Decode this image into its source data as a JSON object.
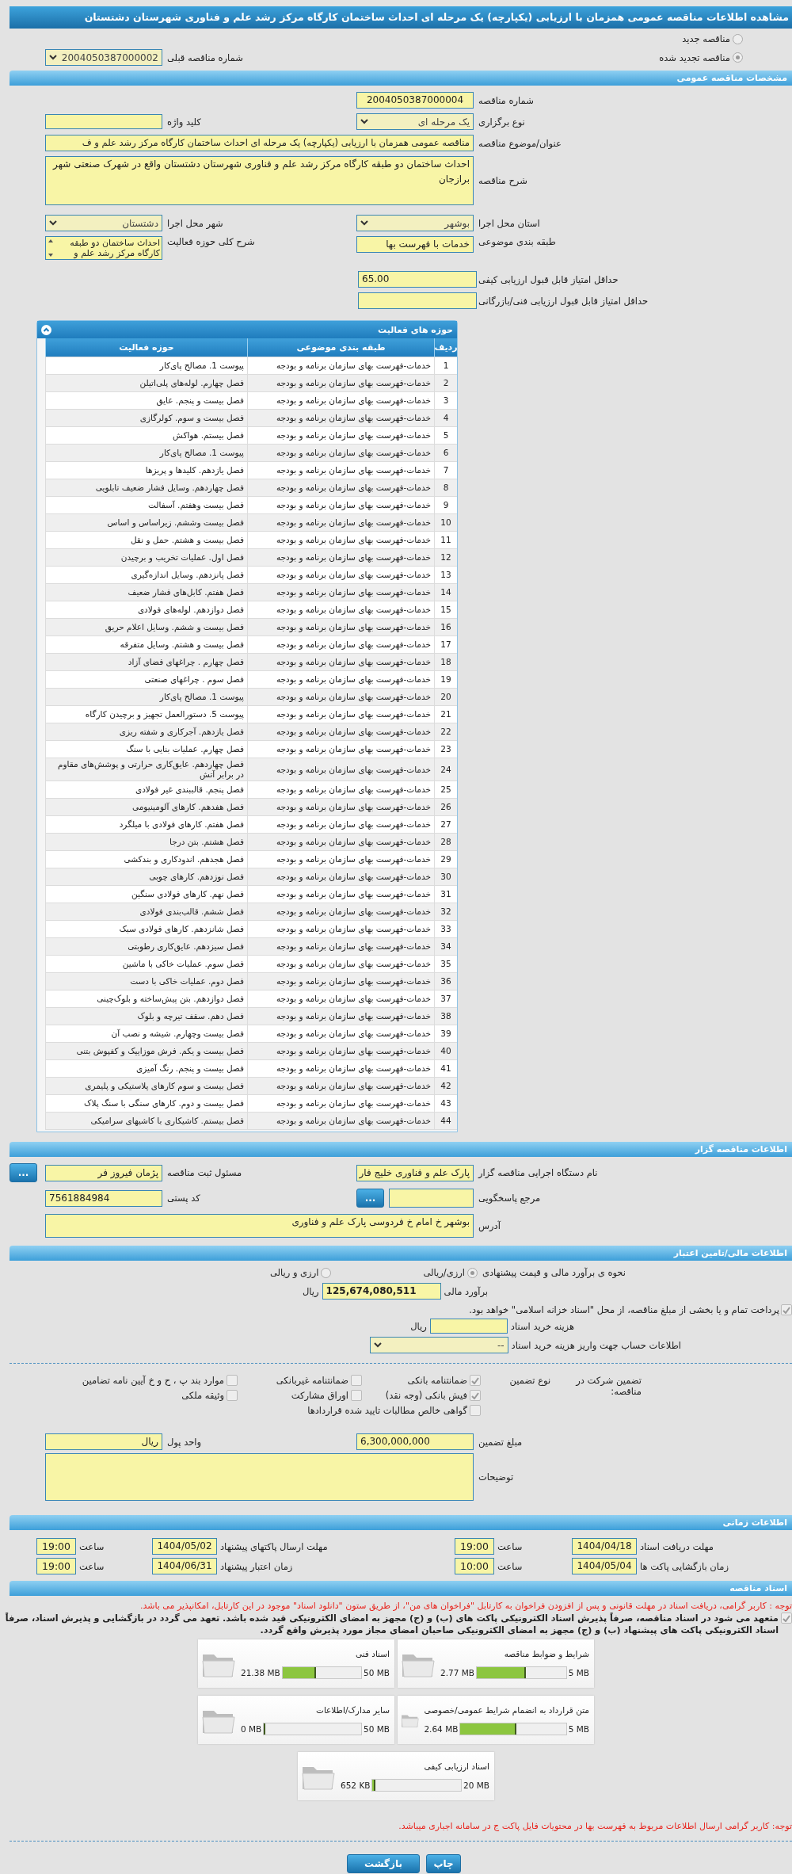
{
  "page_title": "مشاهده اطلاعات مناقصه عمومی همزمان با ارزیابی (یکپارچه) یک مرحله ای احداث ساختمان کارگاه مرکز رشد علم و فناوری شهرستان دشتستان",
  "tender_kind": [
    {
      "label": "مناقصه جدید",
      "selected": false
    },
    {
      "label": "مناقصه تجدید شده",
      "selected": true
    }
  ],
  "previous_tender": {
    "label": "شماره مناقصه قبلی",
    "value": "2004050387000002"
  },
  "general": {
    "title": "مشخصات مناقصه عمومی",
    "tender_number": {
      "label": "شماره مناقصه",
      "value": "2004050387000004"
    },
    "holding_type": {
      "label": "نوع برگزاری",
      "value": "یک مرحله ای"
    },
    "keyword": {
      "label": "کلید واژه"
    },
    "subject": {
      "label": "عنوان/موضوع مناقصه",
      "value": "مناقصه عمومی همزمان با ارزیابی (یکپارچه) یک مرحله ای احداث ساختمان کارگاه مرکز رشد علم و ف"
    },
    "description": {
      "label": "شرح مناقصه",
      "value": "احداث ساختمان دو طبقه کارگاه مرکز رشد علم و فناوری شهرستان دشتستان واقع در شهرک صنعتی شهر برازجان"
    },
    "province": {
      "label": "استان محل اجرا",
      "value": "بوشهر"
    },
    "city": {
      "label": "شهر محل اجرا",
      "value": "دشتستان"
    },
    "category": {
      "label": "طبقه بندی موضوعی",
      "value": "خدمات با فهرست بها"
    },
    "activity_summary": {
      "label": "شرح کلی حوزه فعالیت",
      "value": "احداث ساختمان دو طبقه کارگاه مرکز رشد علم و"
    },
    "quality_min": {
      "label": "حداقل امتیاز قابل قبول ارزیابی کیفی",
      "value": "65.00"
    },
    "technical_min": {
      "label": "حداقل امتیاز قابل قبول ارزیابی فنی/بازرگانی"
    }
  },
  "activities": {
    "title": "حوزه های فعالیت",
    "columns": [
      "ردیف",
      "طبقه بندی موضوعی",
      "حوزه فعالیت"
    ],
    "rows": [
      {
        "row": "1",
        "category": "خدمات-فهرست بهای سازمان برنامه و بودجه",
        "activity": "پیوست 1. مصالح پای‌کار"
      },
      {
        "row": "2",
        "category": "خدمات-فهرست بهای سازمان برنامه و بودجه",
        "activity": "فصل چهارم. لوله‌های پلی‌اتیلن"
      },
      {
        "row": "3",
        "category": "خدمات-فهرست بهای سازمان برنامه و بودجه",
        "activity": "فصل بیست و پنجم. عایق"
      },
      {
        "row": "4",
        "category": "خدمات-فهرست بهای سازمان برنامه و بودجه",
        "activity": "فصل بیست و سوم. کولرگازی"
      },
      {
        "row": "5",
        "category": "خدمات-فهرست بهای سازمان برنامه و بودجه",
        "activity": "فصل بیستم. هواکش"
      },
      {
        "row": "6",
        "category": "خدمات-فهرست بهای سازمان برنامه و بودجه",
        "activity": "پیوست 1. مصالح پای‌کار"
      },
      {
        "row": "7",
        "category": "خدمات-فهرست بهای سازمان برنامه و بودجه",
        "activity": "فصل یازدهم. کلیدها و پریزها"
      },
      {
        "row": "8",
        "category": "خدمات-فهرست بهای سازمان برنامه و بودجه",
        "activity": "فصل چهاردهم. وسایل فشار ضعیف تابلویی"
      },
      {
        "row": "9",
        "category": "خدمات-فهرست بهای سازمان برنامه و بودجه",
        "activity": "فصل بیست وهفتم. آسفالت"
      },
      {
        "row": "10",
        "category": "خدمات-فهرست بهای سازمان برنامه و بودجه",
        "activity": "فصل بیست وششم. زیراساس و اساس"
      },
      {
        "row": "11",
        "category": "خدمات-فهرست بهای سازمان برنامه و بودجه",
        "activity": "فصل بیست و هشتم. حمل و نقل"
      },
      {
        "row": "12",
        "category": "خدمات-فهرست بهای سازمان برنامه و بودجه",
        "activity": "فصل اول. عملیات تخریب و برچیدن"
      },
      {
        "row": "13",
        "category": "خدمات-فهرست بهای سازمان برنامه و بودجه",
        "activity": "فصل پانزدهم. وسایل اندازه‌گیری"
      },
      {
        "row": "14",
        "category": "خدمات-فهرست بهای سازمان برنامه و بودجه",
        "activity": "فصل هفتم. کابل‌های فشار ضعیف"
      },
      {
        "row": "15",
        "category": "خدمات-فهرست بهای سازمان برنامه و بودجه",
        "activity": "فصل دوازدهم. لوله‌های فولادی"
      },
      {
        "row": "16",
        "category": "خدمات-فهرست بهای سازمان برنامه و بودجه",
        "activity": "فصل بیست و ششم. وسایل اعلام حریق"
      },
      {
        "row": "17",
        "category": "خدمات-فهرست بهای سازمان برنامه و بودجه",
        "activity": "فصل بیست و هشتم. وسایل متفرقه"
      },
      {
        "row": "18",
        "category": "خدمات-فهرست بهای سازمان برنامه و بودجه",
        "activity": "فصل چهارم . چراغهای فضای آزاد"
      },
      {
        "row": "19",
        "category": "خدمات-فهرست بهای سازمان برنامه و بودجه",
        "activity": "فصل سوم . چراغهای صنعتی"
      },
      {
        "row": "20",
        "category": "خدمات-فهرست بهای سازمان برنامه و بودجه",
        "activity": "پیوست 1. مصالح پای‌کار"
      },
      {
        "row": "21",
        "category": "خدمات-فهرست بهای سازمان برنامه و بودجه",
        "activity": "پیوست 5. دستورالعمل تجهیز و برچیدن کارگاه"
      },
      {
        "row": "22",
        "category": "خدمات-فهرست بهای سازمان برنامه و بودجه",
        "activity": "فصل یازدهم. آجرکاری و شفته ریزی"
      },
      {
        "row": "23",
        "category": "خدمات-فهرست بهای سازمان برنامه و بودجه",
        "activity": "فصل چهارم. عملیات بنایی با سنگ"
      },
      {
        "row": "24",
        "category": "خدمات-فهرست بهای سازمان برنامه و بودجه",
        "activity": "فصل چهاردهم. عایق‌کاری حرارتی و پوشش‌های مقاوم در برابر آتش"
      },
      {
        "row": "25",
        "category": "خدمات-فهرست بهای سازمان برنامه و بودجه",
        "activity": "فصل پنجم. قالببندی غیر فولادی"
      },
      {
        "row": "26",
        "category": "خدمات-فهرست بهای سازمان برنامه و بودجه",
        "activity": "فصل هفدهم. کارهای آلومینیومی"
      },
      {
        "row": "27",
        "category": "خدمات-فهرست بهای سازمان برنامه و بودجه",
        "activity": "فصل هفتم. کارهای فولادی با میلگرد"
      },
      {
        "row": "28",
        "category": "خدمات-فهرست بهای سازمان برنامه و بودجه",
        "activity": "فصل هشتم. بتن درجا"
      },
      {
        "row": "29",
        "category": "خدمات-فهرست بهای سازمان برنامه و بودجه",
        "activity": "فصل هجدهم. اندودکاری و بندکشی"
      },
      {
        "row": "30",
        "category": "خدمات-فهرست بهای سازمان برنامه و بودجه",
        "activity": "فصل نوزدهم. کارهای چوبی"
      },
      {
        "row": "31",
        "category": "خدمات-فهرست بهای سازمان برنامه و بودجه",
        "activity": "فصل نهم. کارهای فولادی سنگین"
      },
      {
        "row": "32",
        "category": "خدمات-فهرست بهای سازمان برنامه و بودجه",
        "activity": "فصل ششم. قالب‌بندی فولادی"
      },
      {
        "row": "33",
        "category": "خدمات-فهرست بهای سازمان برنامه و بودجه",
        "activity": "فصل شانزدهم. کارهای فولادی سبک"
      },
      {
        "row": "34",
        "category": "خدمات-فهرست بهای سازمان برنامه و بودجه",
        "activity": "فصل سیزدهم. عایق‌کاری رطوبتی"
      },
      {
        "row": "35",
        "category": "خدمات-فهرست بهای سازمان برنامه و بودجه",
        "activity": "فصل سوم. عملیات خاکی با ماشین"
      },
      {
        "row": "36",
        "category": "خدمات-فهرست بهای سازمان برنامه و بودجه",
        "activity": "فصل دوم. عملیات خاکی با دست"
      },
      {
        "row": "37",
        "category": "خدمات-فهرست بهای سازمان برنامه و بودجه",
        "activity": "فصل دوازدهم. بتن پیش‌ساخته و بلوک‌چینی"
      },
      {
        "row": "38",
        "category": "خدمات-فهرست بهای سازمان برنامه و بودجه",
        "activity": "فصل دهم. سقف تیرچه و بلوک"
      },
      {
        "row": "39",
        "category": "خدمات-فهرست بهای سازمان برنامه و بودجه",
        "activity": "فصل بیست وچهارم. شیشه و نصب آن"
      },
      {
        "row": "40",
        "category": "خدمات-فهرست بهای سازمان برنامه و بودجه",
        "activity": "فصل بیست و یکم. فرش موزاییک و کفپوش بتنی"
      },
      {
        "row": "41",
        "category": "خدمات-فهرست بهای سازمان برنامه و بودجه",
        "activity": "فصل بیست و پنجم. رنگ آمیزی"
      },
      {
        "row": "42",
        "category": "خدمات-فهرست بهای سازمان برنامه و بودجه",
        "activity": "فصل بیست و سوم کارهای پلاستیکی و پلیمری"
      },
      {
        "row": "43",
        "category": "خدمات-فهرست بهای سازمان برنامه و بودجه",
        "activity": "فصل بیست و دوم. کارهای سنگی با سنگ پلاک"
      },
      {
        "row": "44",
        "category": "خدمات-فهرست بهای سازمان برنامه و بودجه",
        "activity": "فصل بیستم. کاشیکاری با کاشیهای سرامیکی"
      }
    ]
  },
  "tenderer": {
    "title": "اطلاعات مناقصه گزار",
    "organization": {
      "label": "نام دستگاه اجرایی مناقصه گزار",
      "value": "پارک علم و فناوری خلیج فار"
    },
    "registrar": {
      "label": "مسئول ثبت مناقصه",
      "value": "پژمان فیروز فر",
      "button": "..."
    },
    "reference": {
      "label": "مرجع پاسخگویی",
      "button": "..."
    },
    "postal_code": {
      "label": "کد پستی",
      "value": "7561884984"
    },
    "address": {
      "label": "آدرس",
      "value": "بوشهر خ امام خ فردوسی پارک علم و فناوری"
    }
  },
  "financial": {
    "title": "اطلاعات مالی/تامین اعتبار",
    "pricing": {
      "label": "نحوه ی برآورد مالی و قیمت پیشنهادی",
      "options": [
        {
          "label": "ارزی/ریالی",
          "selected": true
        },
        {
          "label": "ارزی و ریالی",
          "selected": false
        }
      ]
    },
    "estimate": {
      "label": "برآورد مالی",
      "value": "125,674,080,511",
      "unit": "ریال"
    },
    "treasury": {
      "label": "پرداخت تمام و یا بخشی از مبلغ مناقصه، از محل \"اسناد خزانه اسلامی\" خواهد بود.",
      "checked": true
    },
    "document_cost": {
      "label": "هزینه خرید اسناد",
      "unit": "ریال"
    },
    "account": {
      "label": "اطلاعات حساب جهت واریز هزینه خرید اسناد",
      "value": "--"
    },
    "guarantee": {
      "label": "تضمین شرکت در مناقصه:",
      "type_label": "نوع تضمین",
      "options": [
        {
          "label": "ضمانتنامه بانکی",
          "checked": true
        },
        {
          "label": "ضمانتنامه غیربانکی",
          "checked": false
        },
        {
          "label": "موارد بند پ ، ح و خ آیین نامه تضامین",
          "checked": false
        },
        {
          "label": "فیش بانکی (وجه نقد)",
          "checked": true
        },
        {
          "label": "اوراق مشارکت",
          "checked": false
        },
        {
          "label": "وثیقه ملکی",
          "checked": false
        },
        {
          "label": "گواهی خالص مطالبات تایید شده قراردادها",
          "checked": false
        }
      ]
    },
    "guarantee_amount": {
      "label": "مبلغ تضمین",
      "value": "6,300,000,000"
    },
    "currency": {
      "label": "واحد پول",
      "value": "ریال"
    },
    "notes": {
      "label": "توضیحات"
    }
  },
  "timing": {
    "title": "اطلاعات زمانی",
    "items": [
      {
        "label": "مهلت دریافت اسناد",
        "date": "1404/04/18",
        "time_label": "ساعت",
        "time": "19:00"
      },
      {
        "label": "مهلت ارسال پاکتهای پیشنهاد",
        "date": "1404/05/02",
        "time_label": "ساعت",
        "time": "19:00"
      },
      {
        "label": "زمان بازگشایی پاکت ها",
        "date": "1404/05/04",
        "time_label": "ساعت",
        "time": "10:00"
      },
      {
        "label": "زمان اعتبار پیشنهاد",
        "date": "1404/06/31",
        "time_label": "ساعت",
        "time": "19:00"
      }
    ]
  },
  "documents": {
    "title": "اسناد مناقصه",
    "notice": "توجه : کاربر گرامی، دریافت اسناد در مهلت قانونی و پس از افزودن فراخوان به کارتابل \"فراخوان های من\"، از طریق ستون \"دانلود اسناد\" موجود در این کارتابل، امکانپذیر می باشد.",
    "commitment": {
      "checked": true,
      "text": "متعهد می شود در اسناد مناقصه، صرفاً پذیرش اسناد الکترونیکی پاکت های (ب) و (ج) مجهز به امضای الکترونیکی قید شده باشد. تعهد می گردد در بازگشایی و پذیرش اسناد، صرفاً اسناد الکترونیکی پاکت های پیشنهاد (ب) و (ج) مجهز به امضای الکترونیکی صاحبان امضای مجاز مورد پذیرش واقع گردد."
    },
    "files": [
      {
        "name": "شرایط و ضوابط مناقصه",
        "size": "2.77 MB",
        "max": "5 MB",
        "level": 0.55
      },
      {
        "name": "اسناد فنی",
        "size": "21.38 MB",
        "max": "50 MB",
        "level": 0.43
      },
      {
        "name": "متن قرارداد به انضمام شرایط عمومی/خصوصی",
        "size": "2.64 MB",
        "max": "5 MB",
        "level": 0.53
      },
      {
        "name": "سایر مدارک/اطلاعات",
        "size": "0 MB",
        "max": "50 MB",
        "level": 0
      },
      {
        "name": "اسناد ارزیابی کیفی",
        "size": "652 KB",
        "max": "20 MB",
        "level": 0.03
      }
    ],
    "footnote": "توجه: کاربر گرامی ارسال اطلاعات مربوط به فهرست بها در محتویات فایل پاکت ج در سامانه اجباری میباشد."
  },
  "buttons": [
    "چاپ",
    "بازگشت"
  ]
}
